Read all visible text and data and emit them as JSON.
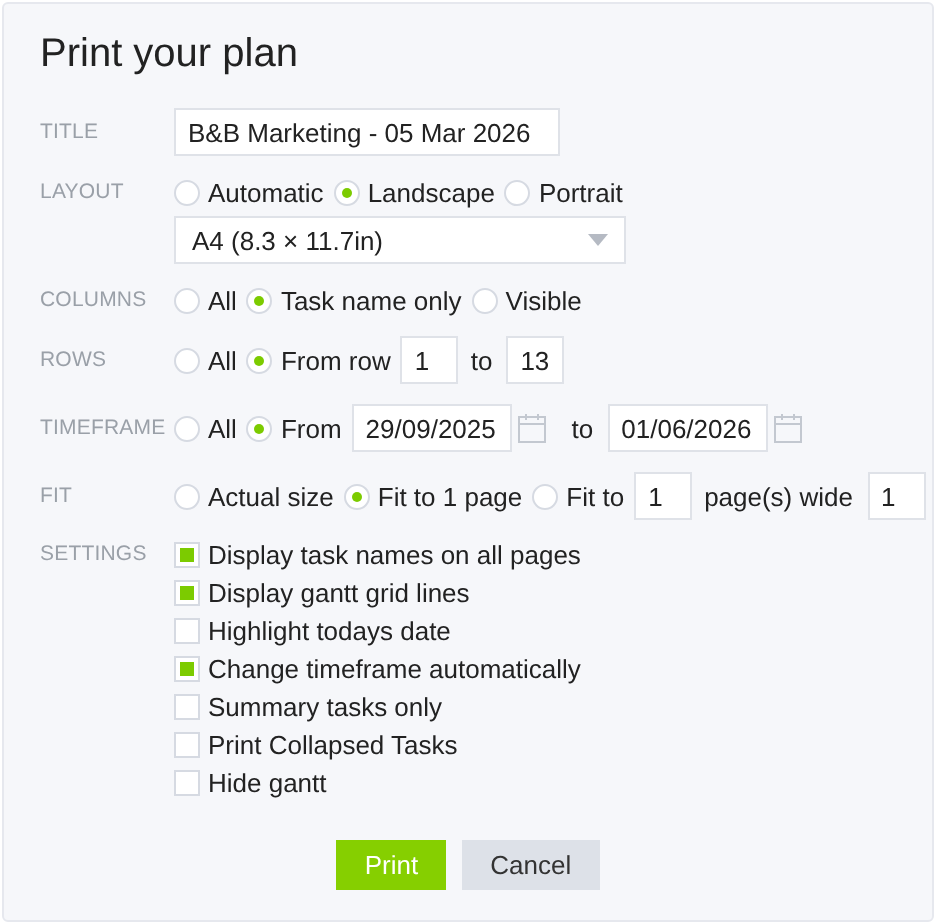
{
  "title": "Print your plan",
  "rows": [
    {
      "label": "TITLE",
      "lines": [
        [
          {
            "kind": "title_input",
            "value": "B&B Marketing - 05 Mar 2026"
          }
        ]
      ]
    },
    {
      "label": "LAYOUT",
      "lines": [
        [
          {
            "kind": "radio",
            "label": "Automatic",
            "selected": false
          },
          {
            "kind": "radio",
            "label": "Landscape",
            "selected": true
          },
          {
            "kind": "radio",
            "label": "Portrait",
            "selected": false
          }
        ],
        [
          {
            "kind": "select",
            "value": "A4 (8.3 × 11.7in)"
          }
        ]
      ]
    },
    {
      "label": "COLUMNS",
      "lines": [
        [
          {
            "kind": "radio",
            "label": "All",
            "selected": false
          },
          {
            "kind": "radio",
            "label": "Task name only",
            "selected": true
          },
          {
            "kind": "radio",
            "label": "Visible",
            "selected": false
          }
        ]
      ]
    },
    {
      "label": "ROWS",
      "lines": [
        [
          {
            "kind": "radio",
            "label": "All",
            "selected": false
          },
          {
            "kind": "radio",
            "label": "From row",
            "selected": true
          },
          {
            "kind": "number",
            "value": "1"
          },
          {
            "kind": "text",
            "label": "to"
          },
          {
            "kind": "number",
            "value": "13"
          }
        ]
      ]
    },
    {
      "label": "TIMEFRAME",
      "lines": [
        [
          {
            "kind": "radio",
            "label": "All",
            "selected": false
          },
          {
            "kind": "radio",
            "label": "From",
            "selected": true
          },
          {
            "kind": "date",
            "value": "29/09/2025"
          },
          {
            "kind": "text",
            "label": "to"
          },
          {
            "kind": "date",
            "value": "01/06/2026"
          }
        ]
      ]
    },
    {
      "label": "FIT",
      "lines": [
        [
          {
            "kind": "radio",
            "label": "Actual size",
            "selected": false
          },
          {
            "kind": "radio",
            "label": "Fit to 1 page",
            "selected": true
          },
          {
            "kind": "radio",
            "label": "Fit to",
            "selected": false
          },
          {
            "kind": "number",
            "value": "1"
          },
          {
            "kind": "text",
            "label": "page(s) wide"
          },
          {
            "kind": "number",
            "value": "1"
          }
        ]
      ]
    },
    {
      "label": "SETTINGS",
      "lines": [
        [
          {
            "kind": "checkbox",
            "label": "Display task names on all pages",
            "checked": true
          }
        ],
        [
          {
            "kind": "checkbox",
            "label": "Display gantt grid lines",
            "checked": true
          }
        ],
        [
          {
            "kind": "checkbox",
            "label": "Highlight todays date",
            "checked": false
          }
        ],
        [
          {
            "kind": "checkbox",
            "label": "Change timeframe automatically",
            "checked": true
          }
        ],
        [
          {
            "kind": "checkbox",
            "label": "Summary tasks only",
            "checked": false
          }
        ],
        [
          {
            "kind": "checkbox",
            "label": "Print Collapsed Tasks",
            "checked": false
          }
        ],
        [
          {
            "kind": "checkbox",
            "label": "Hide gantt",
            "checked": false
          }
        ]
      ]
    }
  ],
  "buttons": [
    {
      "kind": "primary",
      "label": "Print"
    },
    {
      "kind": "secondary",
      "label": "Cancel"
    }
  ]
}
